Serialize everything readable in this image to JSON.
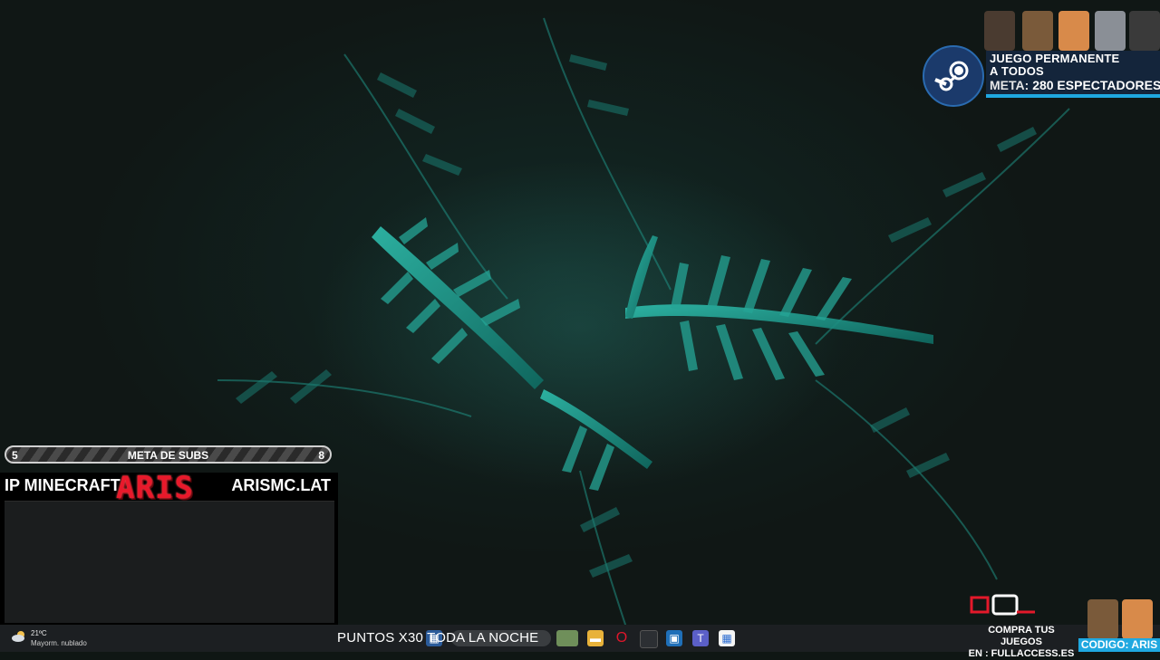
{
  "steam_promo": {
    "line1": "JUEGO PERMANENTE",
    "line2": "A TODOS",
    "meta_label": "META:",
    "meta_value": "280 ESPECTADORES",
    "logo_icon": "steam-icon",
    "accent_color": "#1fa8e0"
  },
  "subs_goal": {
    "current": "5",
    "title": "META DE SUBS",
    "target": "8"
  },
  "minecraft": {
    "ip_label": "IP MINECRAFT",
    "logo_text": "ARIS",
    "address": "ARISMC.LAT",
    "logo_color": "#e8192b"
  },
  "taskbar": {
    "weather_temp": "21ºC",
    "weather_desc": "Mayorm. nublado",
    "weather_icon": "cloud-sun-icon",
    "ticker_text": "PUNTOS X30 TODA LA NOCHE",
    "icons": [
      "start-icon",
      "search-icon",
      "file-explorer-icon",
      "opera-icon",
      "app-icon",
      "photos-icon",
      "teams-icon",
      "store-icon"
    ]
  },
  "fullaccess_promo": {
    "line1": "COMPRA TUS JUEGOS",
    "line2": "EN : FULLACCESS.ES",
    "code": "CODIGO: ARIS"
  }
}
